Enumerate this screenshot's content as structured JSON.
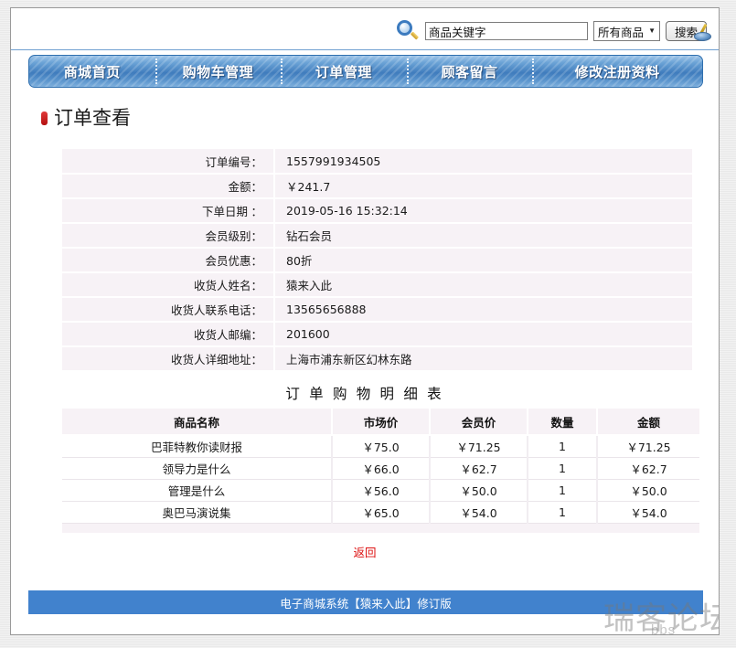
{
  "search": {
    "icon": "search-magnifier-icon",
    "keyword_value": "商品关键字",
    "keyword_placeholder": "商品关键字",
    "category_selected": "所有商品",
    "category_caret": "▼",
    "search_button": "搜索"
  },
  "nav": {
    "items": [
      {
        "label": "商城首页"
      },
      {
        "label": "购物车管理"
      },
      {
        "label": "订单管理"
      },
      {
        "label": "顾客留言"
      },
      {
        "label": "修改注册资料"
      }
    ]
  },
  "heading": {
    "title": "订单查看"
  },
  "order_info": {
    "rows": [
      {
        "label": "订单编号：",
        "value": "1557991934505"
      },
      {
        "label": "金额：",
        "value": "￥241.7"
      },
      {
        "label": "下单日期 ：",
        "value": "2019-05-16  15:32:14"
      },
      {
        "label": "会员级别：",
        "value": "钻石会员"
      },
      {
        "label": "会员优惠：",
        "value": "80折"
      },
      {
        "label": "收货人姓名：",
        "value": "猿来入此"
      },
      {
        "label": "收货人联系电话：",
        "value": "13565656888"
      },
      {
        "label": "收货人邮编：",
        "value": "201600"
      },
      {
        "label": "收货人详细地址：",
        "value": "上海市浦东新区幻林东路"
      }
    ]
  },
  "detail": {
    "title": "订 单 购 物 明 细 表",
    "columns": [
      "商品名称",
      "市场价",
      "会员价",
      "数量",
      "金额"
    ],
    "rows": [
      {
        "name": "巴菲特教你读财报",
        "market": "￥75.0",
        "member": "￥71.25",
        "qty": "1",
        "amount": "￥71.25"
      },
      {
        "name": "领导力是什么",
        "market": "￥66.0",
        "member": "￥62.7",
        "qty": "1",
        "amount": "￥62.7"
      },
      {
        "name": "管理是什么",
        "market": "￥56.0",
        "member": "￥50.0",
        "qty": "1",
        "amount": "￥50.0"
      },
      {
        "name": "奥巴马演说集",
        "market": "￥65.0",
        "member": "￥54.0",
        "qty": "1",
        "amount": "￥54.0"
      }
    ]
  },
  "actions": {
    "back": "返回"
  },
  "footer": {
    "text": "电子商城系统【猿来入此】修订版"
  },
  "watermark": {
    "text": "瑞客论坛",
    "sub": "bbs"
  },
  "colors": {
    "nav_blue": "#3f7cbd",
    "footer_blue": "#4182cd",
    "row_bg": "#f7f2f6",
    "accent_red": "#dd1111",
    "heading_bullet": "#b30f0f"
  }
}
